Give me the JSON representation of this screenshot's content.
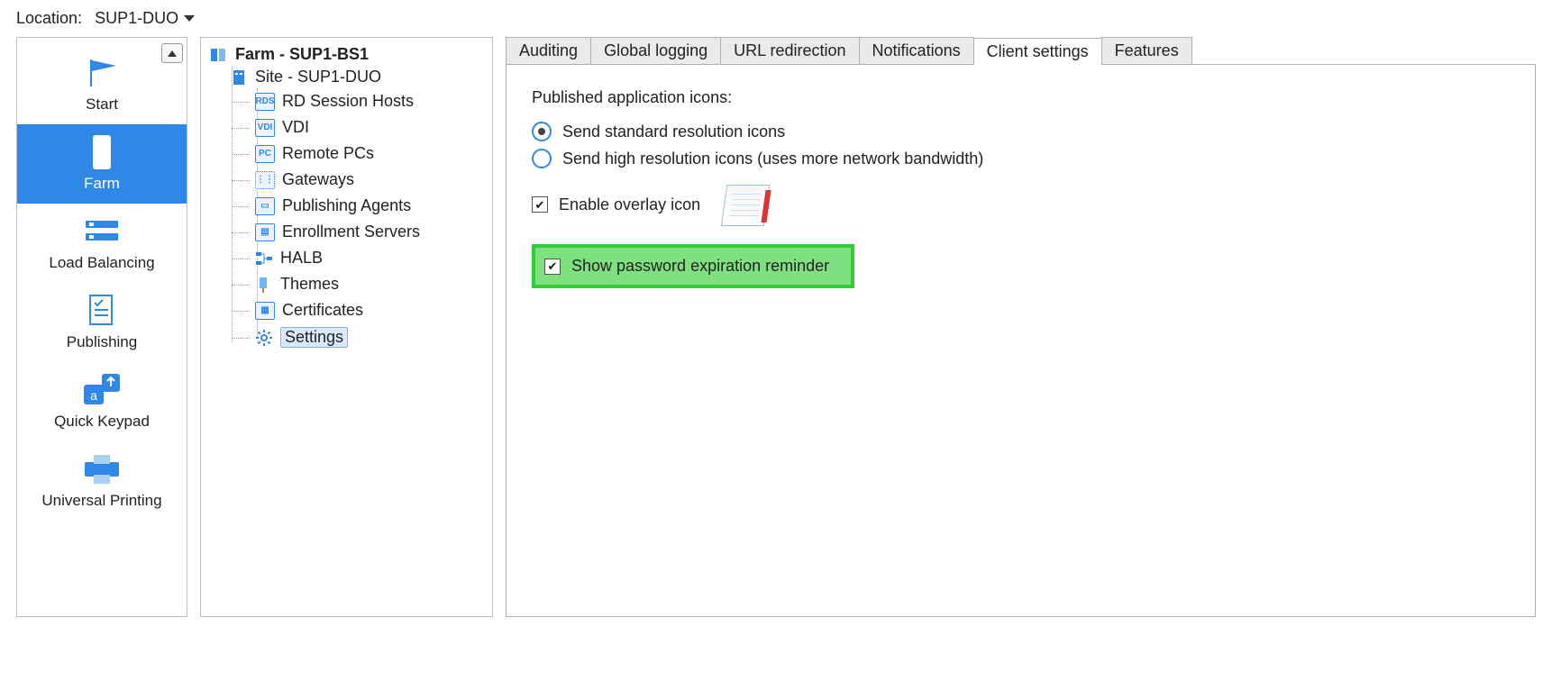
{
  "location": {
    "label": "Location:",
    "value": "SUP1-DUO"
  },
  "nav": [
    {
      "id": "start",
      "label": "Start",
      "selected": false
    },
    {
      "id": "farm",
      "label": "Farm",
      "selected": true
    },
    {
      "id": "loadbalancing",
      "label": "Load Balancing",
      "selected": false
    },
    {
      "id": "publishing",
      "label": "Publishing",
      "selected": false
    },
    {
      "id": "quickkeypad",
      "label": "Quick Keypad",
      "selected": false
    },
    {
      "id": "universalprinting",
      "label": "Universal Printing",
      "selected": false
    }
  ],
  "tree": {
    "root": "Farm - SUP1-BS1",
    "site": "Site - SUP1-DUO",
    "items": [
      {
        "label": "RD Session Hosts",
        "badge": "RDS"
      },
      {
        "label": "VDI",
        "badge": "VDI"
      },
      {
        "label": "Remote PCs",
        "badge": "PC"
      },
      {
        "label": "Gateways",
        "badge": ""
      },
      {
        "label": "Publishing Agents",
        "badge": ""
      },
      {
        "label": "Enrollment Servers",
        "badge": ""
      },
      {
        "label": "HALB",
        "badge": ""
      },
      {
        "label": "Themes",
        "badge": ""
      },
      {
        "label": "Certificates",
        "badge": ""
      },
      {
        "label": "Settings",
        "badge": "",
        "selected": true
      }
    ]
  },
  "tabs": [
    {
      "label": "Auditing",
      "active": false
    },
    {
      "label": "Global logging",
      "active": false
    },
    {
      "label": "URL redirection",
      "active": false
    },
    {
      "label": "Notifications",
      "active": false
    },
    {
      "label": "Client settings",
      "active": true
    },
    {
      "label": "Features",
      "active": false
    }
  ],
  "content": {
    "published_icons_title": "Published application icons:",
    "radio_standard": "Send standard resolution icons",
    "radio_high": "Send high resolution icons (uses more network bandwidth)",
    "radio_selected": "standard",
    "check_overlay": "Enable overlay icon",
    "check_overlay_checked": true,
    "check_pwd_expiry": "Show password expiration reminder",
    "check_pwd_expiry_checked": true
  },
  "colors": {
    "accent": "#2f88e5",
    "highlight": "#32cd32"
  }
}
